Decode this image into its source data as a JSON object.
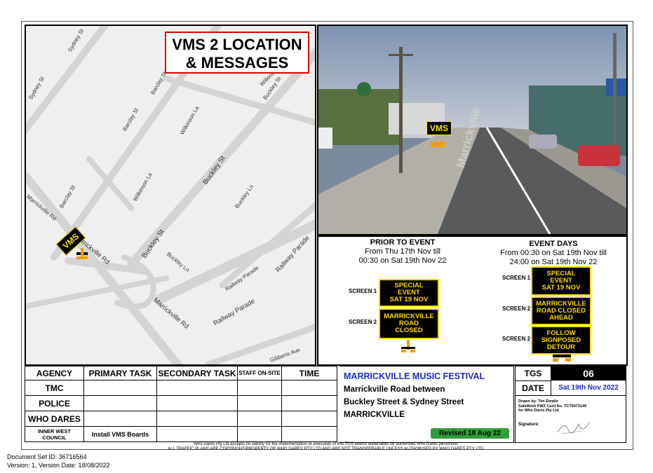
{
  "title": {
    "line1": "VMS 2 LOCATION",
    "line2": "& MESSAGES"
  },
  "map": {
    "streets": [
      "Sydney St",
      "Sydney St",
      "Barclay St",
      "Barclay St",
      "Barclay St",
      "Wilkinson La",
      "Wilkinson La",
      "Buckley St",
      "Buckley St",
      "Buckley St",
      "Buckley Ln",
      "Buckley Ln",
      "Marrickville Rd",
      "Marrickville Rd",
      "Marrickville Rd",
      "Railway Parade",
      "Railway Parade",
      "Railway Parade",
      "Wilkinson Pl",
      "Gibbens Ave"
    ],
    "vms_label": "VMS"
  },
  "photo": {
    "vms_label": "VMS",
    "road_text": "Marrickville"
  },
  "messages": {
    "prior": {
      "heading": "PRIOR TO EVENT",
      "line1": "From Thu 17th Nov till",
      "line2": "00:30 on Sat 19th Nov 22",
      "screens": [
        {
          "label": "SCREEN 1",
          "text": [
            "SPECIAL",
            "EVENT",
            "SAT 19 NOV"
          ]
        },
        {
          "label": "SCREEN 2",
          "text": [
            "MARRICKVILLE",
            "ROAD",
            "CLOSED"
          ]
        }
      ]
    },
    "event": {
      "heading": "EVENT DAYS",
      "line1": "From 00:30 on Sat 19th Nov till",
      "line2": "24:00 on Sat 19th Nov 22",
      "screens": [
        {
          "label": "SCREEN 1",
          "text": [
            "SPECIAL",
            "EVENT",
            "SAT 19 NOV"
          ]
        },
        {
          "label": "SCREEN 2",
          "text": [
            "MARRICKVILLE",
            "ROAD CLOSED",
            "AHEAD"
          ]
        },
        {
          "label": "SCREEN 2",
          "text": [
            "FOLLOW",
            "SIGNPOSED",
            "DETOUR"
          ]
        }
      ]
    }
  },
  "table": {
    "headers": [
      "AGENCY",
      "PRIMARY TASK",
      "SECONDARY TASK",
      "STAFF ON-SITE",
      "TIME"
    ],
    "rows": [
      {
        "agency": "TMC",
        "primary": "",
        "secondary": "",
        "staff": "",
        "time": ""
      },
      {
        "agency": "POLICE",
        "primary": "",
        "secondary": "",
        "staff": "",
        "time": ""
      },
      {
        "agency": "WHO DARES",
        "primary": "",
        "secondary": "",
        "staff": "",
        "time": ""
      },
      {
        "agency": "INNER WEST COUNCIL",
        "primary": "Install VMS Boards",
        "secondary": "",
        "staff": "",
        "time": ""
      }
    ]
  },
  "info": {
    "event_name": "MARRICKVILLE MUSIC FESTIVAL",
    "line1": "Marrickville Road between",
    "line2": "Buckley Street & Sydney Street",
    "line3": "MARRICKVILLE",
    "revised": "Revised 18 Aug 22"
  },
  "tgs": {
    "tgs_label": "TGS",
    "tgs_value": "06",
    "date_label": "DATE",
    "date_value": "Sat 19th Nov 2022",
    "drawn_by": "Drawn by: Tim Emalie",
    "card": "SafeWork PWZ Card No. TCT0073149",
    "for": "for Who Dares Pty Ltd",
    "signature_label": "Signature:"
  },
  "footer": {
    "disclaimer1": "Who Dares Pty Ltd accepts no liability for the implementation or execution of this TGS unless undertaken by authorised Who Dares personnel.",
    "disclaimer2": "ALL TRAFFIC PLANS ARE COPYRIGHT/PROPERTY OF WHO DARES PTY LTD AND ARE NOT TRANSFERABLE UNLESS AUTHORISED BY WHO DARES PTY LTD.",
    "doc_id": "Document Set ID: 36716564",
    "version": "Version: 1, Version Date: 18/08/2022"
  },
  "colors": {
    "title_border": "#e00000",
    "sign_yellow": "#ffd800",
    "event_blue": "#1f28c8",
    "revised_green": "#2f9e3a"
  }
}
